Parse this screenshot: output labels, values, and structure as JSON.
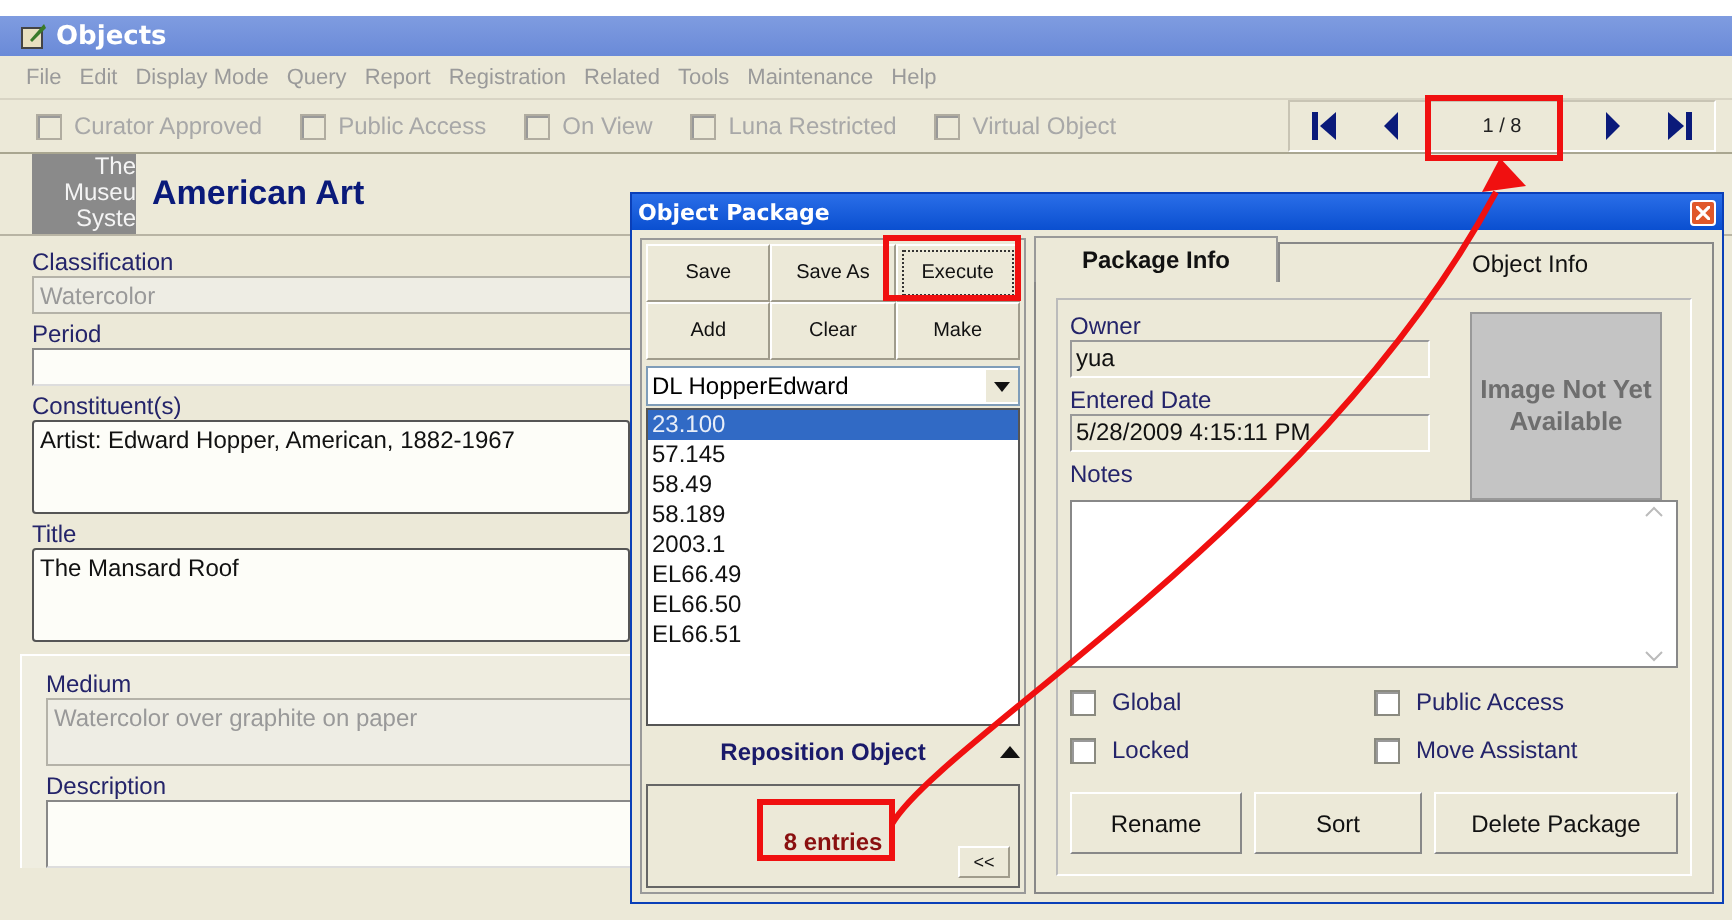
{
  "window": {
    "title": "Objects"
  },
  "menu": [
    "File",
    "Edit",
    "Display Mode",
    "Query",
    "Report",
    "Registration",
    "Related",
    "Tools",
    "Maintenance",
    "Help"
  ],
  "flags": [
    {
      "label": "Curator Approved",
      "checked": false
    },
    {
      "label": "Public Access",
      "checked": false
    },
    {
      "label": "On View",
      "checked": false
    },
    {
      "label": "Luna Restricted",
      "checked": false
    },
    {
      "label": "Virtual Object",
      "checked": false
    }
  ],
  "navigator": {
    "position": "1 / 8"
  },
  "logo": [
    "The",
    "Museu",
    "Syste"
  ],
  "department": "American Art",
  "fields": [
    {
      "label": "Classification",
      "value": "Watercolor",
      "disabled": true,
      "kind": "line"
    },
    {
      "label": "Period",
      "disabled": false,
      "kind": "line"
    },
    {
      "label": "Constituent(s)",
      "value": "Artist:  Edward Hopper, American, 1882-1967",
      "disabled": false,
      "kind": "box"
    },
    {
      "label": "Title",
      "value": "The Mansard Roof",
      "disabled": false,
      "kind": "box"
    },
    {
      "label": "Medium",
      "value": "Watercolor over graphite on paper",
      "disabled": true,
      "kind": "inset"
    },
    {
      "label": "Description",
      "disabled": false,
      "kind": "inset"
    }
  ],
  "dialog": {
    "title": "Object Package",
    "buttons": [
      "Save",
      "Save As",
      "Execute",
      "Add",
      "Clear",
      "Make"
    ],
    "package": "DL HopperEdward",
    "objects": [
      {
        "label": "23.100",
        "selected": true
      },
      {
        "label": "57.145",
        "selected": false
      },
      {
        "label": "58.49",
        "selected": false
      },
      {
        "label": "58.189",
        "selected": false
      },
      {
        "label": "2003.1",
        "selected": false
      },
      {
        "label": "EL66.49",
        "selected": false
      },
      {
        "label": "EL66.50",
        "selected": false
      },
      {
        "label": "EL66.51",
        "selected": false
      }
    ],
    "reposition": "Reposition Object",
    "count": "8 entries",
    "collapse": "<<",
    "tabs": [
      {
        "label": "Package Info",
        "selected": true
      },
      {
        "label": "Object Info",
        "selected": false
      }
    ],
    "owner": {
      "label": "Owner",
      "value": "yua"
    },
    "entered": {
      "label": "Entered Date",
      "value": "5/28/2009 4:15:11 PM"
    },
    "image": "Image Not Yet Available",
    "notes": {
      "label": "Notes"
    },
    "options": [
      {
        "label": "Global",
        "checked": false
      },
      {
        "label": "Public Access",
        "checked": false
      },
      {
        "label": "Locked",
        "checked": false
      },
      {
        "label": "Move Assistant",
        "checked": false
      }
    ],
    "actions": [
      "Rename",
      "Sort",
      "Delete Package"
    ]
  }
}
